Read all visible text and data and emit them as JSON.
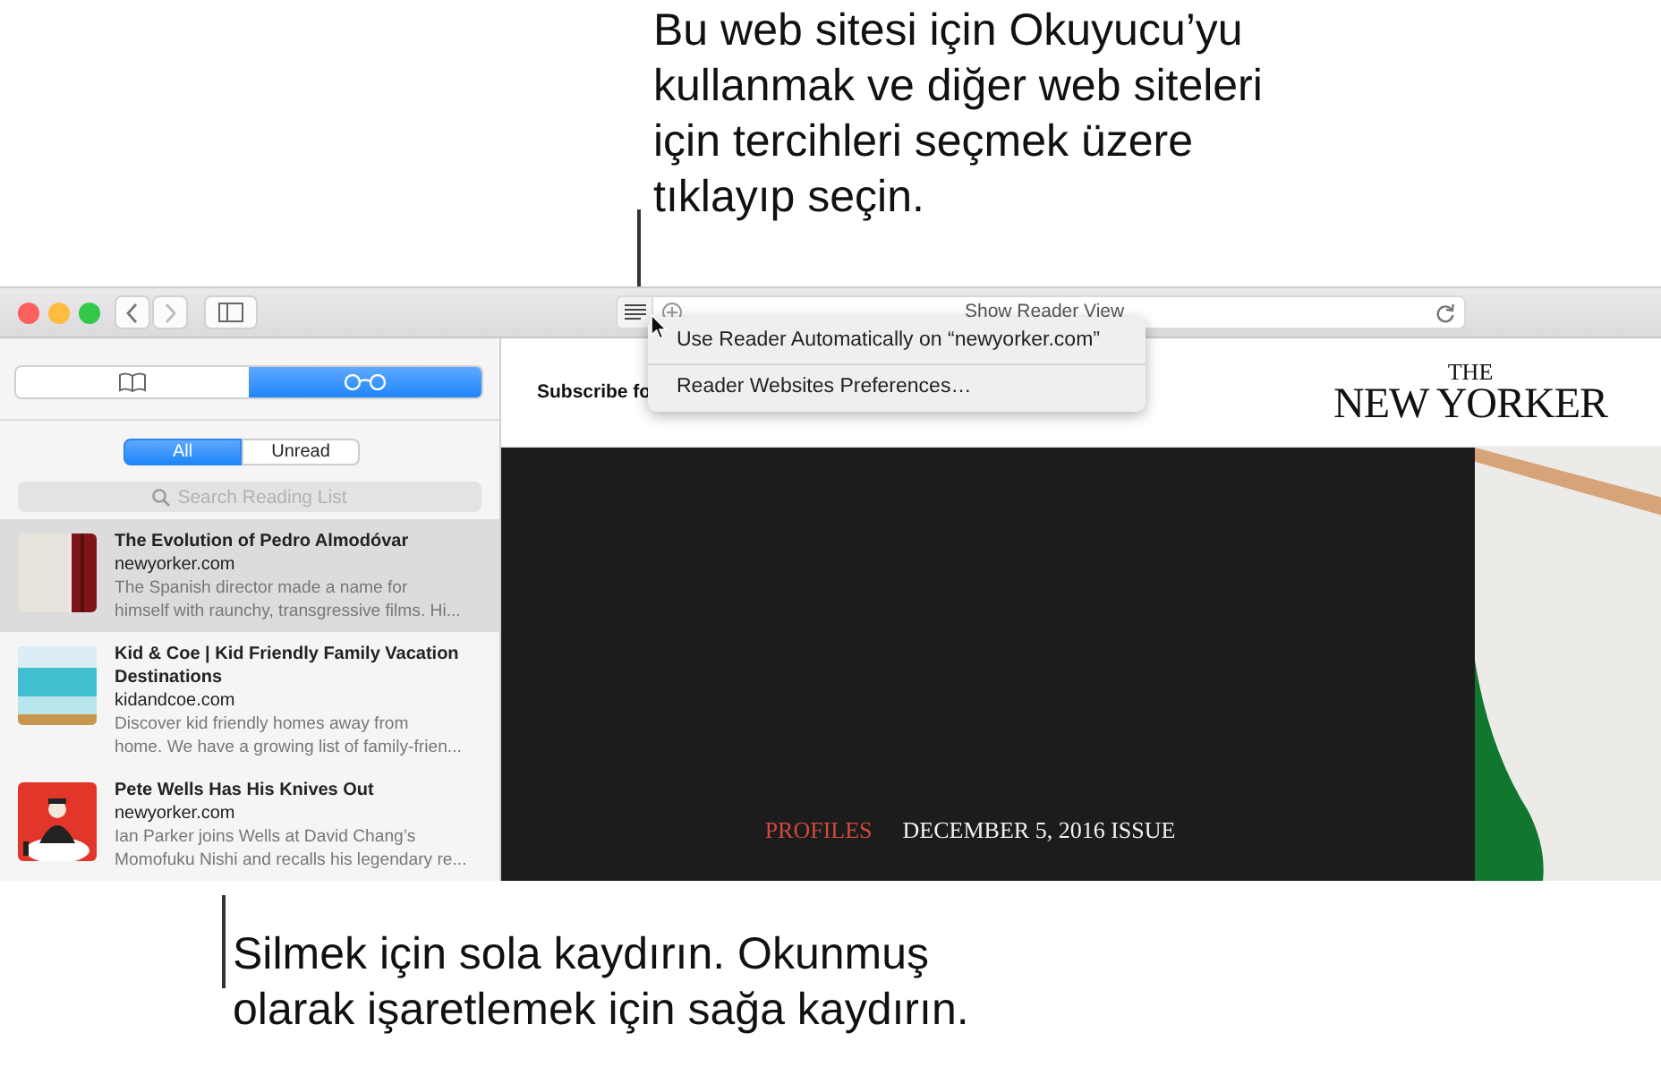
{
  "callout_top": {
    "text": "Bu web sitesi için Okuyucu’yu\nkullanmak ve diğer web siteleri\niçin tercihleri seçmek üzere\ntıklayıp seçin."
  },
  "address_bar": {
    "text": "Show Reader View"
  },
  "reader_menu": {
    "items": [
      {
        "label": "Use Reader Automatically on “newyorker.com”"
      },
      {
        "label": "Reader Websites Preferences…"
      }
    ]
  },
  "sidebar": {
    "tabs": [
      {
        "kind": "bookmarks",
        "selected": false
      },
      {
        "kind": "reading-list",
        "selected": true
      }
    ],
    "filters": [
      {
        "label": "All",
        "selected": true
      },
      {
        "label": "Unread",
        "selected": false
      }
    ],
    "search": {
      "placeholder": "Search Reading List"
    },
    "items": [
      {
        "title": "The Evolution of Pedro Almodóvar",
        "site": "newyorker.com",
        "description": "The Spanish director made a name for\nhimself with raunchy, transgressive films. Hi...",
        "selected": true,
        "kind": "curtain"
      },
      {
        "title": "Kid & Coe | Kid Friendly Family Vacation\nDestinations",
        "site": "kidandcoe.com",
        "description": "Discover kid friendly homes away from\nhome. We have a growing list of family-frien...",
        "selected": false,
        "kind": "beach"
      },
      {
        "title": "Pete Wells Has His Knives Out",
        "site": "newyorker.com",
        "description": "Ian Parker joins Wells at David Chang’s\nMomofuku Nishi and recalls his legendary re...",
        "selected": false,
        "kind": "diner"
      }
    ]
  },
  "page": {
    "subscribe": "Subscribe fo",
    "logo_top": "THE",
    "logo": "NEW YORKER",
    "section": "PROFILES",
    "issue": "DECEMBER 5, 2016 ISSUE"
  },
  "callout_bottom": {
    "text": "Silmek için sola kaydırın. Okunmuş\nolarak işaretlemek için sağa kaydırın."
  }
}
